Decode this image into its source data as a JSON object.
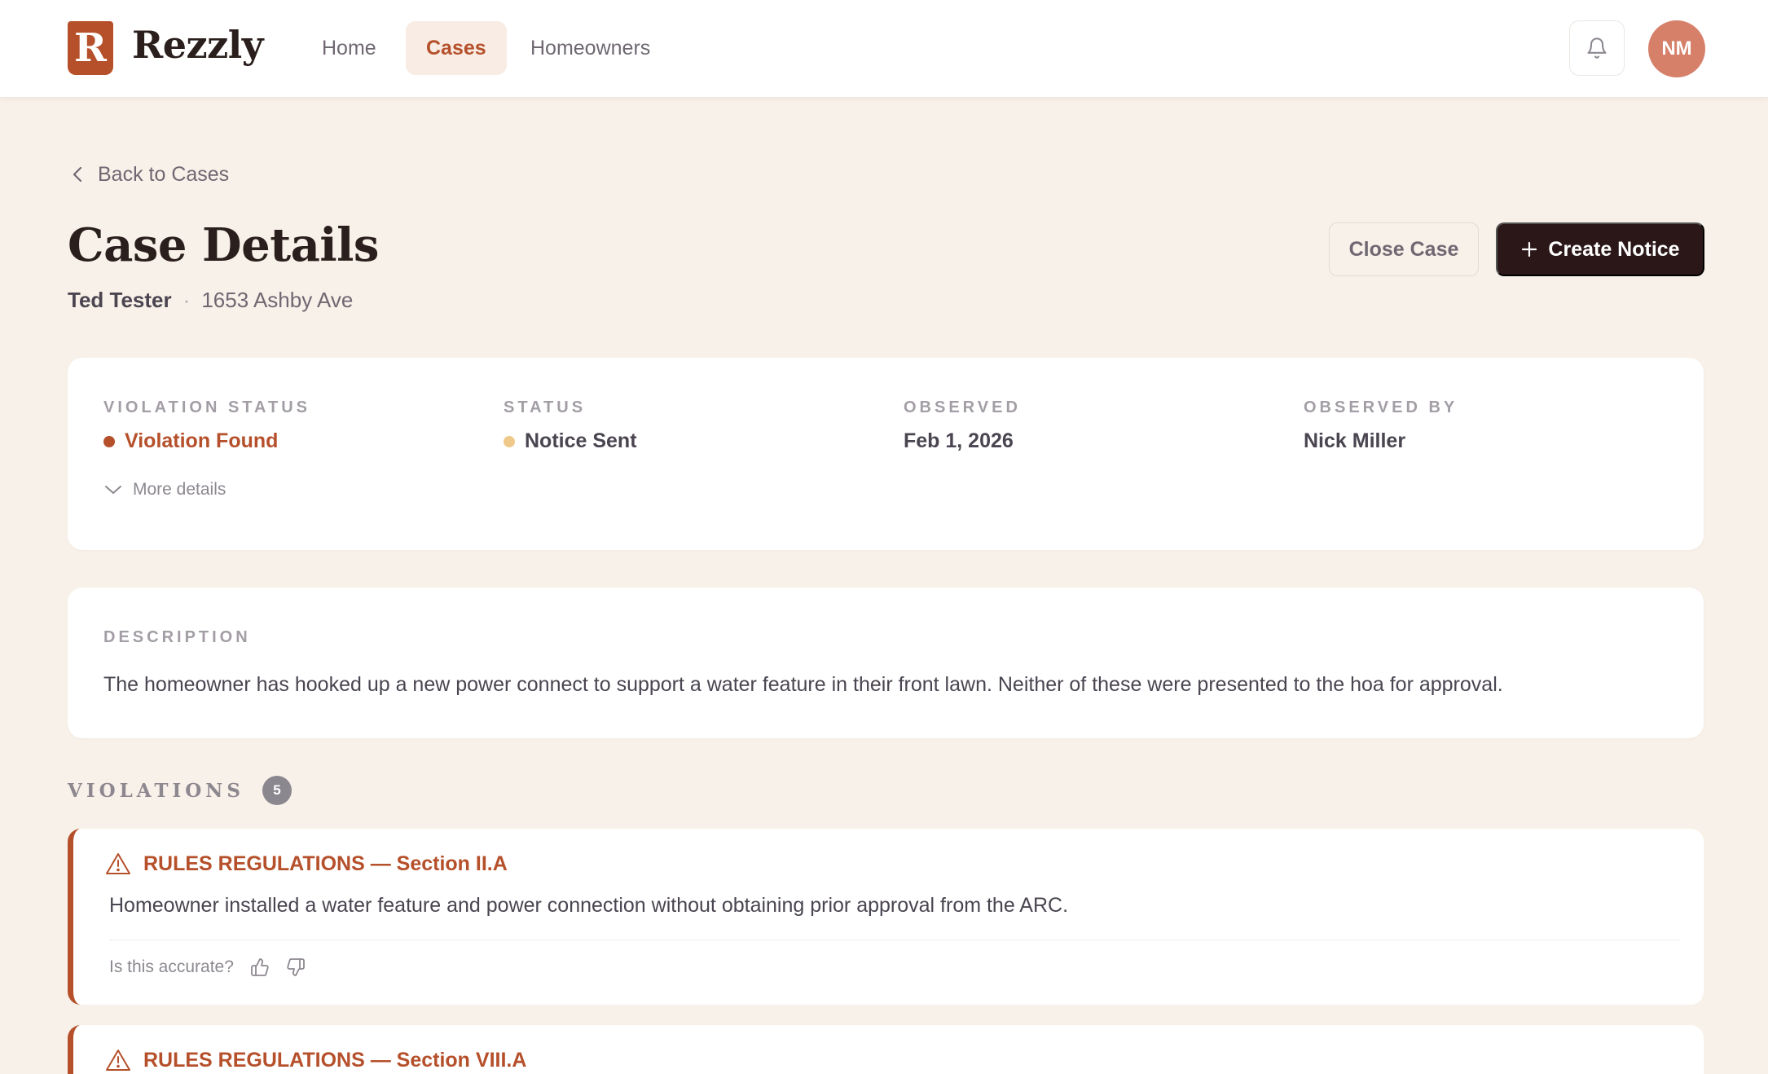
{
  "nav": {
    "logo_letter": "R",
    "brand": "Rezzly",
    "items": [
      {
        "label": "Home",
        "active": false
      },
      {
        "label": "Cases",
        "active": true
      },
      {
        "label": "Homeowners",
        "active": false
      }
    ],
    "avatar_initials": "NM"
  },
  "header": {
    "back_label": "Back to Cases",
    "title": "Case Details",
    "homeowner": "Ted Tester",
    "separator": "·",
    "address": "1653 Ashby Ave",
    "close_label": "Close Case",
    "create_label": "Create Notice"
  },
  "status_card": {
    "fields": [
      {
        "label": "VIOLATION STATUS",
        "value": "Violation Found",
        "dot_color": "#b5502b",
        "value_color": "#b5502b"
      },
      {
        "label": "STATUS",
        "value": "Notice Sent",
        "dot_color": "#efc98a",
        "value_color": "#4a4550"
      },
      {
        "label": "OBSERVED",
        "value": "Feb 1, 2026"
      },
      {
        "label": "OBSERVED BY",
        "value": "Nick Miller"
      }
    ],
    "more_details": "More details"
  },
  "description": {
    "label": "DESCRIPTION",
    "text": "The homeowner has hooked up a new power connect to support a water feature in their front lawn. Neither of these were presented to the hoa for approval."
  },
  "violations": {
    "title": "VIOLATIONS",
    "count": "5",
    "items": [
      {
        "title": "RULES REGULATIONS — Section II.A",
        "text": "Homeowner installed a water feature and power connection without obtaining prior approval from the ARC.",
        "feedback_prompt": "Is this accurate?"
      },
      {
        "title": "RULES REGULATIONS — Section VIII.A"
      }
    ]
  },
  "colors": {
    "accent": "#b5502b",
    "dark_button": "#2b1718",
    "background": "#f8f1e9"
  }
}
